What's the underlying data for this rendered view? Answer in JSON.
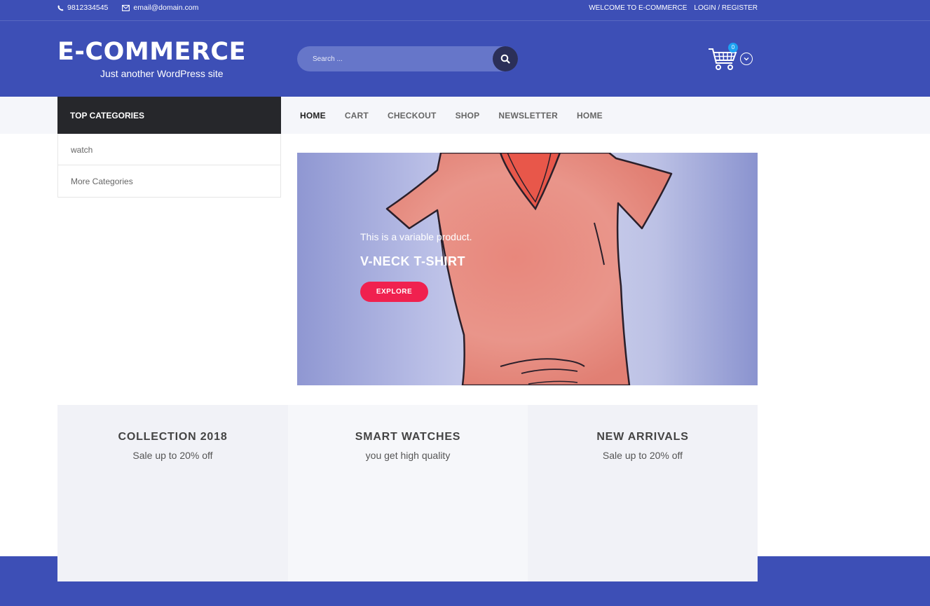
{
  "topbar": {
    "phone": "9812334545",
    "email": "email@domain.com",
    "welcome": "WELCOME TO E-COMMERCE",
    "login": "LOGIN / REGISTER"
  },
  "header": {
    "site_title": "E-COMMERCE",
    "tagline": "Just another WordPress site",
    "search_placeholder": "Search ...",
    "cart_count": "0"
  },
  "sidebar": {
    "heading": "TOP CATEGORIES",
    "items": [
      {
        "label": "watch"
      },
      {
        "label": "More Categories"
      }
    ]
  },
  "nav": {
    "items": [
      {
        "label": "HOME"
      },
      {
        "label": "CART"
      },
      {
        "label": "CHECKOUT"
      },
      {
        "label": "SHOP"
      },
      {
        "label": "NEWSLETTER"
      },
      {
        "label": "HOME"
      }
    ]
  },
  "hero": {
    "subtitle": "This is a variable product.",
    "title": "V-NECK T-SHIRT",
    "button": "EXPLORE"
  },
  "features": [
    {
      "title": "COLLECTION 2018",
      "subtitle": "Sale up to 20% off"
    },
    {
      "title": "SMART WATCHES",
      "subtitle": "you get high quality"
    },
    {
      "title": "NEW ARRIVALS",
      "subtitle": "Sale up to 20% off"
    }
  ],
  "colors": {
    "primary": "#3d4fb6",
    "dark": "#26272b",
    "accent": "#f0214f",
    "badge": "#1da1f2"
  },
  "icons": {
    "phone": "phone-icon",
    "email": "envelope-icon",
    "search": "search-icon",
    "cart": "shopping-cart-icon",
    "dropdown": "chevron-down-icon"
  }
}
